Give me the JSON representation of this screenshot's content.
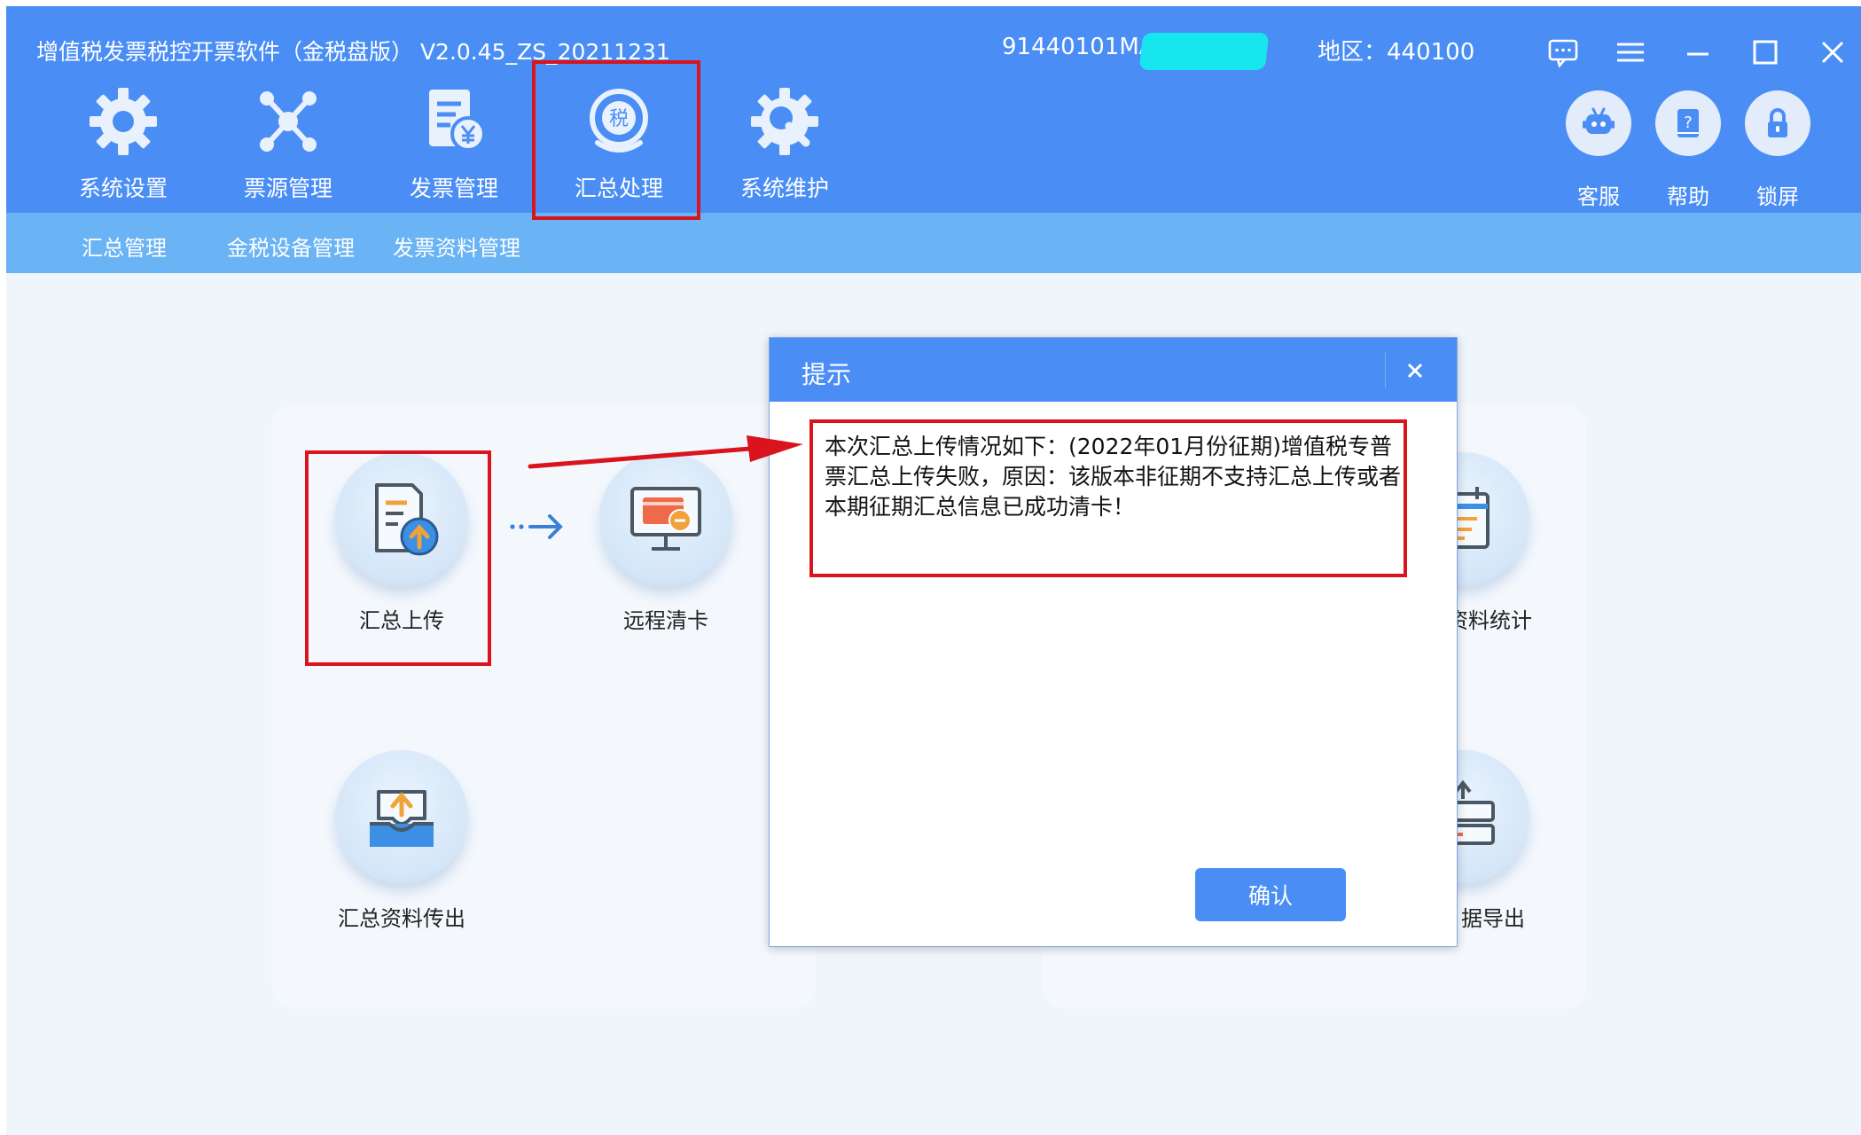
{
  "window": {
    "title": "增值税发票税控开票软件（金税盘版）  V2.0.45_ZS_20211231",
    "tax_id": "91440101MA",
    "region": "地区：440100",
    "controls": [
      "message-icon",
      "menu-icon",
      "minimize-icon",
      "maximize-icon",
      "close-icon"
    ]
  },
  "nav": {
    "items": [
      {
        "label": "系统设置",
        "icon": "gear-icon"
      },
      {
        "label": "票源管理",
        "icon": "network-icon"
      },
      {
        "label": "发票管理",
        "icon": "invoice-yen-icon"
      },
      {
        "label": "汇总处理",
        "icon": "tax-seal-icon",
        "selected": true
      },
      {
        "label": "系统维护",
        "icon": "wrench-gear-icon"
      }
    ],
    "right": [
      {
        "label": "客服",
        "icon": "robot-icon"
      },
      {
        "label": "帮助",
        "icon": "help-book-icon"
      },
      {
        "label": "锁屏",
        "icon": "lock-icon"
      }
    ]
  },
  "subnav": {
    "items": [
      "汇总管理",
      "金税设备管理",
      "发票资料管理"
    ]
  },
  "functions": {
    "left": [
      {
        "label": "汇总上传",
        "icon": "document-upload-icon"
      },
      {
        "label": "远程清卡",
        "icon": "monitor-card-icon"
      },
      {
        "label": "汇总资料传出",
        "icon": "tray-upload-icon"
      }
    ],
    "right": [
      {
        "label": "资料统计",
        "icon": "calendar-list-icon"
      },
      {
        "label": "据导出",
        "icon": "data-export-icon"
      }
    ]
  },
  "dialog": {
    "title": "提示",
    "message": "本次汇总上传情况如下：(2022年01月份征期)增值税专普票汇总上传失败，原因：该版本非征期不支持汇总上传或者本期征期汇总信息已成功清卡！",
    "ok_label": "确认"
  },
  "colors": {
    "primary": "#4a8ef5",
    "subbar": "#6ab3f5",
    "background": "#eef5fb",
    "annotation_red": "#d9141c",
    "redaction": "#17e6ee"
  }
}
